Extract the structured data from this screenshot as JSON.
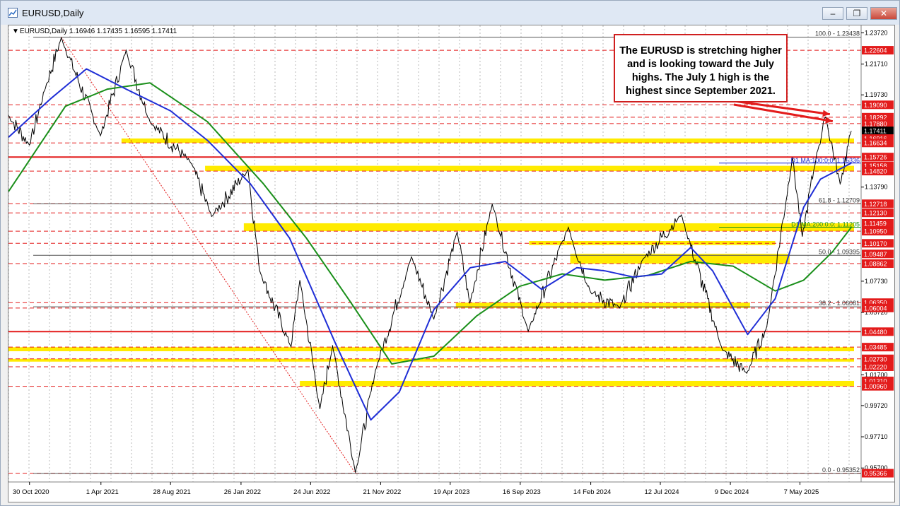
{
  "window": {
    "title": "EURUSD,Daily",
    "buttons": {
      "minimize": "–",
      "restore": "❐",
      "close": "✕"
    }
  },
  "chart_data": {
    "type": "line",
    "symbol_header": "EURUSD,Daily  1.16946 1.17435 1.16595 1.17411",
    "y_range": [
      0.948,
      1.242
    ],
    "x_range": [
      "2020-09-15",
      "2025-09-15"
    ],
    "x_ticks": [
      {
        "date": "2020-10-30",
        "label": "30 Oct 2020"
      },
      {
        "date": "2021-04-01",
        "label": "1 Apr 2021"
      },
      {
        "date": "2021-08-28",
        "label": "28 Aug 2021"
      },
      {
        "date": "2022-01-26",
        "label": "26 Jan 2022"
      },
      {
        "date": "2022-06-24",
        "label": "24 Jun 2022"
      },
      {
        "date": "2022-11-21",
        "label": "21 Nov 2022"
      },
      {
        "date": "2023-04-19",
        "label": "19 Apr 2023"
      },
      {
        "date": "2023-09-16",
        "label": "16 Sep 2023"
      },
      {
        "date": "2024-02-14",
        "label": "14 Feb 2024"
      },
      {
        "date": "2024-07-12",
        "label": "12 Jul 2024"
      },
      {
        "date": "2024-12-09",
        "label": "9 Dec 2024"
      },
      {
        "date": "2025-05-07",
        "label": "7 May 2025"
      }
    ],
    "y_ticks": [
      "1.23720",
      "1.21710",
      "1.19730",
      "1.13790",
      "1.07730",
      "1.05720",
      "1.01700",
      "0.99720",
      "0.97710",
      "0.95700"
    ],
    "price_labels": [
      {
        "value": "1.22604",
        "kind": "red"
      },
      {
        "value": "1.19090",
        "kind": "red"
      },
      {
        "value": "1.18292",
        "kind": "red"
      },
      {
        "value": "1.17880",
        "kind": "red"
      },
      {
        "value": "1.17411",
        "kind": "current"
      },
      {
        "value": "1.16916",
        "kind": "red"
      },
      {
        "value": "1.16634",
        "kind": "red"
      },
      {
        "value": "1.15726",
        "kind": "red"
      },
      {
        "value": "1.15158",
        "kind": "red"
      },
      {
        "value": "1.14820",
        "kind": "red"
      },
      {
        "value": "1.12718",
        "kind": "red"
      },
      {
        "value": "1.12130",
        "kind": "red"
      },
      {
        "value": "1.11459",
        "kind": "red"
      },
      {
        "value": "1.10950",
        "kind": "red"
      },
      {
        "value": "1.10170",
        "kind": "red"
      },
      {
        "value": "1.09487",
        "kind": "red"
      },
      {
        "value": "1.08862",
        "kind": "red"
      },
      {
        "value": "1.06350",
        "kind": "red"
      },
      {
        "value": "1.06004",
        "kind": "red"
      },
      {
        "value": "1.04480",
        "kind": "red"
      },
      {
        "value": "1.03485",
        "kind": "red"
      },
      {
        "value": "1.02730",
        "kind": "red"
      },
      {
        "value": "1.02220",
        "kind": "red"
      },
      {
        "value": "1.01310",
        "kind": "red"
      },
      {
        "value": "1.00960",
        "kind": "red"
      },
      {
        "value": "0.95366",
        "kind": "red"
      }
    ],
    "fib_levels": [
      {
        "value": 1.23438,
        "label": "100.0 - 1.23438"
      },
      {
        "value": 1.12709,
        "label": "61.8 - 1.12709"
      },
      {
        "value": 1.09395,
        "label": "50.0 - 1.09395"
      },
      {
        "value": 1.06081,
        "label": "38.2 - 1.06081"
      },
      {
        "value": 0.95352,
        "label": "0.0 - 0.95352"
      }
    ],
    "ma_labels": [
      {
        "value": 1.15336,
        "label": "D1 MA:100:0:0: 1.15336",
        "color": "#1f2ed6"
      },
      {
        "value": 1.11205,
        "label": "D1 MA:200:0:0: 1.11205",
        "color": "#1a8f1a"
      }
    ],
    "red_lines": [
      1.15726,
      1.0448
    ],
    "dashed_red_lines": [
      1.22604,
      1.1909,
      1.18292,
      1.1788,
      1.16634,
      1.1482,
      1.12718,
      1.1213,
      1.1095,
      1.1017,
      1.08862,
      1.0635,
      1.06004,
      1.03485,
      1.0273,
      1.0222,
      1.0096,
      0.95366
    ],
    "zones": [
      {
        "from": "2021-05-15",
        "lo": 1.1664,
        "hi": 1.1692
      },
      {
        "from": "2021-11-10",
        "lo": 1.1482,
        "hi": 1.1516
      },
      {
        "from": "2022-02-01",
        "lo": 1.1095,
        "hi": 1.1146
      },
      {
        "from": "2023-10-05",
        "lo": 1.1006,
        "hi": 1.1032,
        "to": "2025-03-15"
      },
      {
        "from": "2024-01-01",
        "lo": 1.0886,
        "hi": 1.0949,
        "to": "2025-04-15"
      },
      {
        "from": "2023-05-01",
        "lo": 1.06,
        "hi": 1.0635,
        "to": "2025-01-20"
      },
      {
        "from": "2020-09-15",
        "lo": 1.0322,
        "hi": 1.0348
      },
      {
        "from": "2020-09-15",
        "lo": 1.0255,
        "hi": 1.0273
      },
      {
        "from": "2022-06-01",
        "lo": 1.0096,
        "hi": 1.0131
      }
    ],
    "close_prices": [
      [
        "2020-09-15",
        1.184
      ],
      [
        "2020-10-30",
        1.165
      ],
      [
        "2020-12-01",
        1.2
      ],
      [
        "2021-01-06",
        1.234
      ],
      [
        "2021-03-31",
        1.171
      ],
      [
        "2021-05-25",
        1.226
      ],
      [
        "2021-07-15",
        1.18
      ],
      [
        "2021-10-12",
        1.153
      ],
      [
        "2021-11-24",
        1.119
      ],
      [
        "2022-02-10",
        1.149
      ],
      [
        "2022-03-07",
        1.084
      ],
      [
        "2022-05-13",
        1.035
      ],
      [
        "2022-06-01",
        1.078
      ],
      [
        "2022-07-14",
        0.995
      ],
      [
        "2022-08-10",
        1.036
      ],
      [
        "2022-09-28",
        0.954
      ],
      [
        "2022-11-10",
        1.02
      ],
      [
        "2023-01-26",
        1.093
      ],
      [
        "2023-03-15",
        1.053
      ],
      [
        "2023-05-04",
        1.109
      ],
      [
        "2023-05-31",
        1.063
      ],
      [
        "2023-07-18",
        1.127
      ],
      [
        "2023-10-03",
        1.045
      ],
      [
        "2023-12-28",
        1.112
      ],
      [
        "2024-02-14",
        1.07
      ],
      [
        "2024-04-16",
        1.06
      ],
      [
        "2024-06-04",
        1.091
      ],
      [
        "2024-08-26",
        1.12
      ],
      [
        "2024-11-22",
        1.033
      ],
      [
        "2025-01-13",
        1.018
      ],
      [
        "2025-02-25",
        1.048
      ],
      [
        "2025-04-21",
        1.157
      ],
      [
        "2025-05-12",
        1.106
      ],
      [
        "2025-06-12",
        1.16
      ],
      [
        "2025-07-01",
        1.183
      ],
      [
        "2025-08-01",
        1.14
      ],
      [
        "2025-08-25",
        1.174
      ]
    ],
    "ma100_points": [
      [
        "2020-09-15",
        1.17
      ],
      [
        "2020-12-15",
        1.195
      ],
      [
        "2021-03-01",
        1.214
      ],
      [
        "2021-05-25",
        1.201
      ],
      [
        "2021-08-28",
        1.187
      ],
      [
        "2021-11-15",
        1.168
      ],
      [
        "2022-02-15",
        1.14
      ],
      [
        "2022-05-10",
        1.105
      ],
      [
        "2022-08-15",
        1.038
      ],
      [
        "2022-10-31",
        0.988
      ],
      [
        "2022-12-31",
        1.006
      ],
      [
        "2023-03-15",
        1.059
      ],
      [
        "2023-06-01",
        1.086
      ],
      [
        "2023-08-15",
        1.09
      ],
      [
        "2023-11-01",
        1.072
      ],
      [
        "2024-01-15",
        1.086
      ],
      [
        "2024-03-15",
        1.084
      ],
      [
        "2024-05-15",
        1.08
      ],
      [
        "2024-07-15",
        1.082
      ],
      [
        "2024-09-15",
        1.099
      ],
      [
        "2024-11-01",
        1.084
      ],
      [
        "2025-01-15",
        1.043
      ],
      [
        "2025-03-15",
        1.066
      ],
      [
        "2025-05-15",
        1.125
      ],
      [
        "2025-06-20",
        1.143
      ],
      [
        "2025-08-25",
        1.1534
      ]
    ],
    "ma200_points": [
      [
        "2020-09-15",
        1.135
      ],
      [
        "2021-01-15",
        1.19
      ],
      [
        "2021-04-15",
        1.201
      ],
      [
        "2021-07-15",
        1.205
      ],
      [
        "2021-11-15",
        1.18
      ],
      [
        "2022-03-15",
        1.14
      ],
      [
        "2022-06-15",
        1.105
      ],
      [
        "2022-09-15",
        1.065
      ],
      [
        "2022-12-15",
        1.024
      ],
      [
        "2023-03-15",
        1.029
      ],
      [
        "2023-06-15",
        1.055
      ],
      [
        "2023-09-15",
        1.074
      ],
      [
        "2023-12-15",
        1.082
      ],
      [
        "2024-03-15",
        1.078
      ],
      [
        "2024-06-15",
        1.081
      ],
      [
        "2024-09-15",
        1.09
      ],
      [
        "2024-12-15",
        1.087
      ],
      [
        "2025-03-15",
        1.071
      ],
      [
        "2025-05-15",
        1.078
      ],
      [
        "2025-07-15",
        1.096
      ],
      [
        "2025-08-25",
        1.112
      ]
    ],
    "fib_trendline": [
      [
        "2021-01-06",
        1.23438
      ],
      [
        "2022-09-28",
        0.95352
      ]
    ],
    "annotation": "The EURUSD is stretching higher and is looking toward the July highs. The July 1 high is the highest since September 2021."
  },
  "colors": {
    "zone": "#ffeb00",
    "red": "#e31b1b",
    "ma100": "#1f2ed6",
    "ma200": "#1a8f1a",
    "price": "#000000",
    "grid": "#b8b8b8",
    "current_label": "#000000"
  }
}
